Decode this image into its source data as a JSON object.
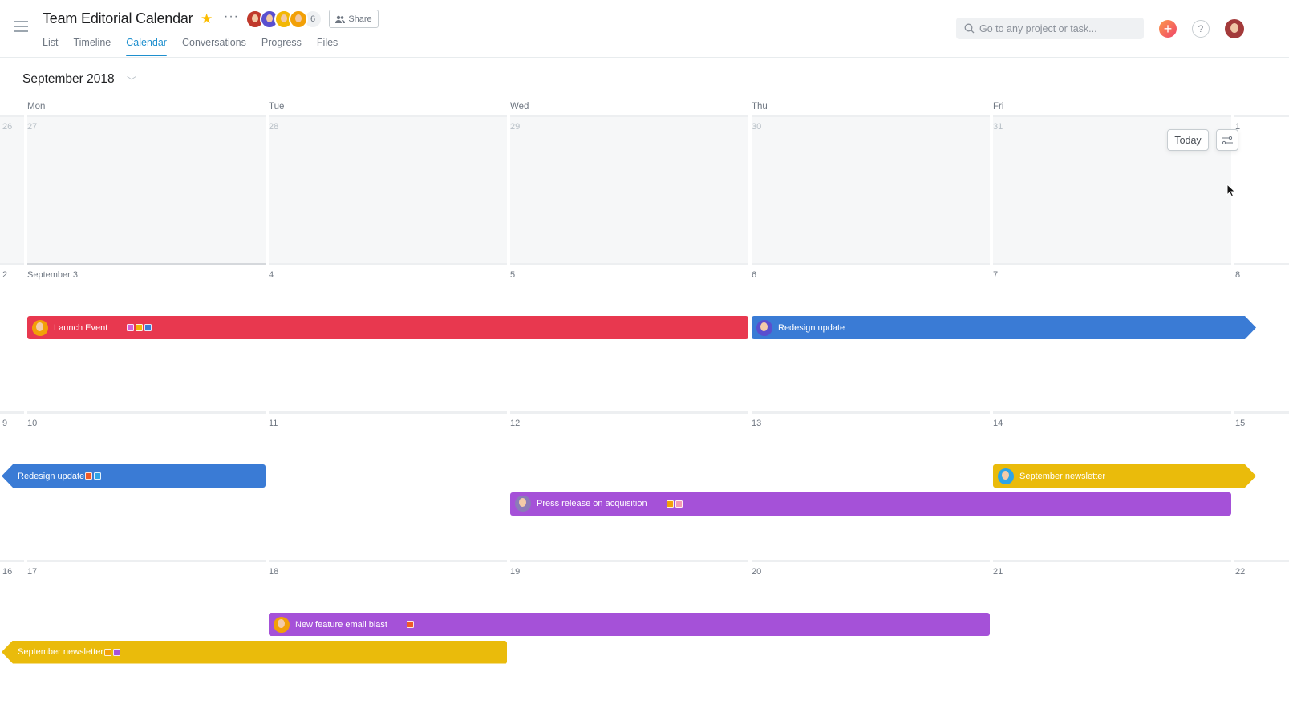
{
  "header": {
    "title": "Team Editorial Calendar",
    "more_label": "···",
    "member_count": "6",
    "share_label": "Share",
    "members": [
      {
        "name": "member-1",
        "color": "#c0392b"
      },
      {
        "name": "member-2",
        "color": "#5a4fcf"
      },
      {
        "name": "member-3",
        "color": "#f2b705"
      },
      {
        "name": "member-4",
        "color": "#f2a007"
      }
    ]
  },
  "tabs": [
    {
      "label": "List",
      "active": false
    },
    {
      "label": "Timeline",
      "active": false
    },
    {
      "label": "Calendar",
      "active": true
    },
    {
      "label": "Conversations",
      "active": false
    },
    {
      "label": "Progress",
      "active": false
    },
    {
      "label": "Files",
      "active": false
    }
  ],
  "search": {
    "placeholder": "Go to any project or task...",
    "value": ""
  },
  "help_label": "?",
  "plus_label": "+",
  "calendar": {
    "month_label": "September 2018",
    "weekdays": [
      "Mon",
      "Tue",
      "Wed",
      "Thu",
      "Fri"
    ],
    "today_label": "Today",
    "weeks": [
      {
        "days": [
          "26",
          "27",
          "28",
          "29",
          "30",
          "31",
          "1"
        ],
        "past": true
      },
      {
        "days": [
          "2",
          "September 3",
          "4",
          "5",
          "6",
          "7",
          "8"
        ],
        "past": false
      },
      {
        "days": [
          "9",
          "10",
          "11",
          "12",
          "13",
          "14",
          "15"
        ],
        "past": false
      },
      {
        "days": [
          "16",
          "17",
          "18",
          "19",
          "20",
          "21",
          "22"
        ],
        "past": false
      }
    ],
    "events": [
      {
        "title": "Launch Event",
        "color": "#e8384f",
        "week": 1,
        "start": 1,
        "end": 3,
        "row": 0,
        "avatar": "#f2a007",
        "cont_left": false,
        "cont_right": false,
        "tags": [
          "#d65ed5",
          "#f2b705",
          "#3a7bd5"
        ],
        "tag_gap": true
      },
      {
        "title": "Redesign update",
        "color": "#3a7bd5",
        "week": 1,
        "start": 4,
        "end": 6,
        "row": 0,
        "avatar": "#5a4fcf",
        "cont_left": false,
        "cont_right": true,
        "tags": [],
        "tag_gap": false
      },
      {
        "title": "Redesign update",
        "color": "#3a7bd5",
        "week": 2,
        "start": 0,
        "end": 1,
        "row": 0,
        "avatar": null,
        "cont_left": true,
        "cont_right": false,
        "tags": [
          "#f05a28",
          "#2ea4e6"
        ],
        "tag_gap": false
      },
      {
        "title": "September newsletter",
        "color": "#eabb0b",
        "week": 2,
        "start": 5,
        "end": 6,
        "row": 0,
        "avatar": "#2ea4e6",
        "cont_left": false,
        "cont_right": true,
        "tags": [],
        "tag_gap": false
      },
      {
        "title": "Press release on acquisition",
        "color": "#a551d8",
        "week": 2,
        "start": 3,
        "end": 5,
        "row": 1,
        "avatar": "#8b7bb8",
        "cont_left": false,
        "cont_right": false,
        "tags": [
          "#f2a007",
          "#f49ab2"
        ],
        "tag_gap": true
      },
      {
        "title": "New feature email blast",
        "color": "#a551d8",
        "week": 3,
        "start": 2,
        "end": 4,
        "row": 0,
        "avatar": "#f2a007",
        "cont_left": false,
        "cont_right": false,
        "tags": [
          "#f05a28"
        ],
        "tag_gap": true
      },
      {
        "title": "September newsletter",
        "color": "#eabb0b",
        "week": 3,
        "start": 0,
        "end": 2,
        "row": 1,
        "avatar": null,
        "cont_left": true,
        "cont_right": false,
        "tags": [
          "#f2a007",
          "#a551d8"
        ],
        "tag_gap": false
      }
    ]
  }
}
